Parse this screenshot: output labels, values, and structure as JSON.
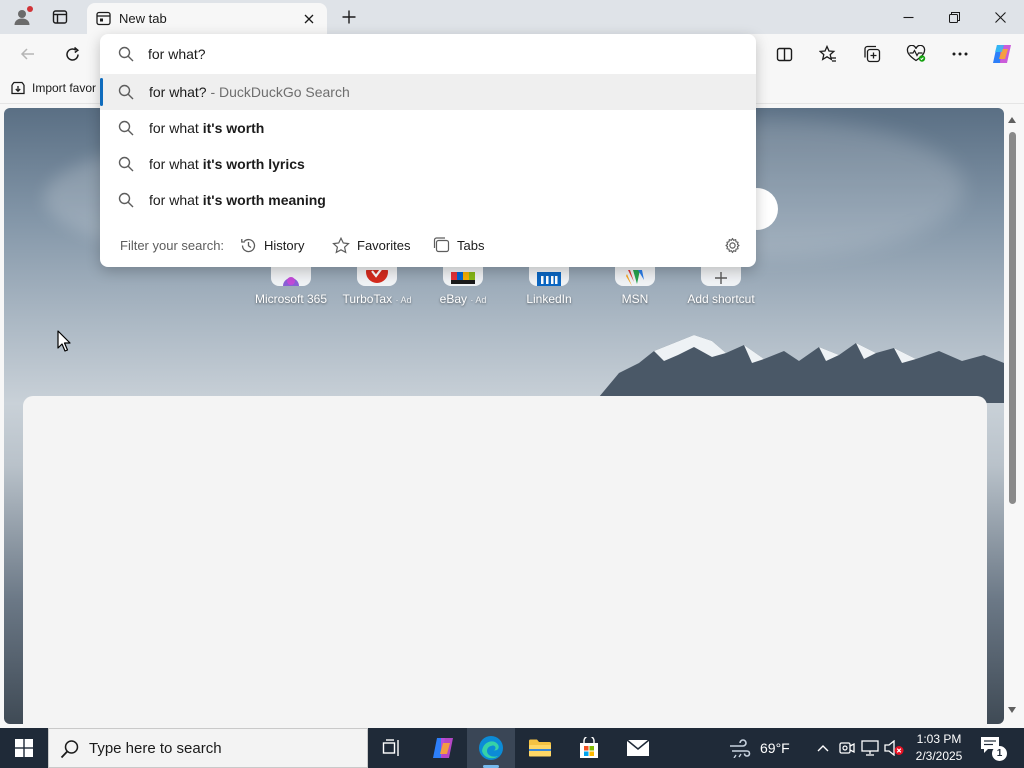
{
  "browser": {
    "tab": {
      "title": "New tab"
    },
    "favorites_bar": {
      "import_label": "Import favor"
    }
  },
  "omnibox": {
    "query": "for what?",
    "suggestions": [
      {
        "plain": "for what?",
        "bold": "",
        "suffix": " - DuckDuckGo Search"
      },
      {
        "plain": "for what ",
        "bold": "it's worth",
        "suffix": ""
      },
      {
        "plain": "for what ",
        "bold": "it's worth lyrics",
        "suffix": ""
      },
      {
        "plain": "for what ",
        "bold": "it's worth meaning",
        "suffix": ""
      }
    ],
    "filter": {
      "label": "Filter your search:",
      "history": "History",
      "favorites": "Favorites",
      "tabs": "Tabs"
    }
  },
  "shortcuts": [
    {
      "name": "Microsoft 365",
      "ad": ""
    },
    {
      "name": "TurboTax",
      "ad": "· Ad"
    },
    {
      "name": "eBay",
      "ad": "· Ad"
    },
    {
      "name": "LinkedIn",
      "ad": ""
    },
    {
      "name": "MSN",
      "ad": ""
    },
    {
      "name": "Add shortcut",
      "ad": ""
    }
  ],
  "taskbar": {
    "search_placeholder": "Type here to search",
    "weather": "69°F",
    "time": "1:03 PM",
    "date": "2/3/2025",
    "notification_count": "1"
  },
  "colors": {
    "accent": "#0f6cbd",
    "taskbar": "#1f2a38"
  }
}
